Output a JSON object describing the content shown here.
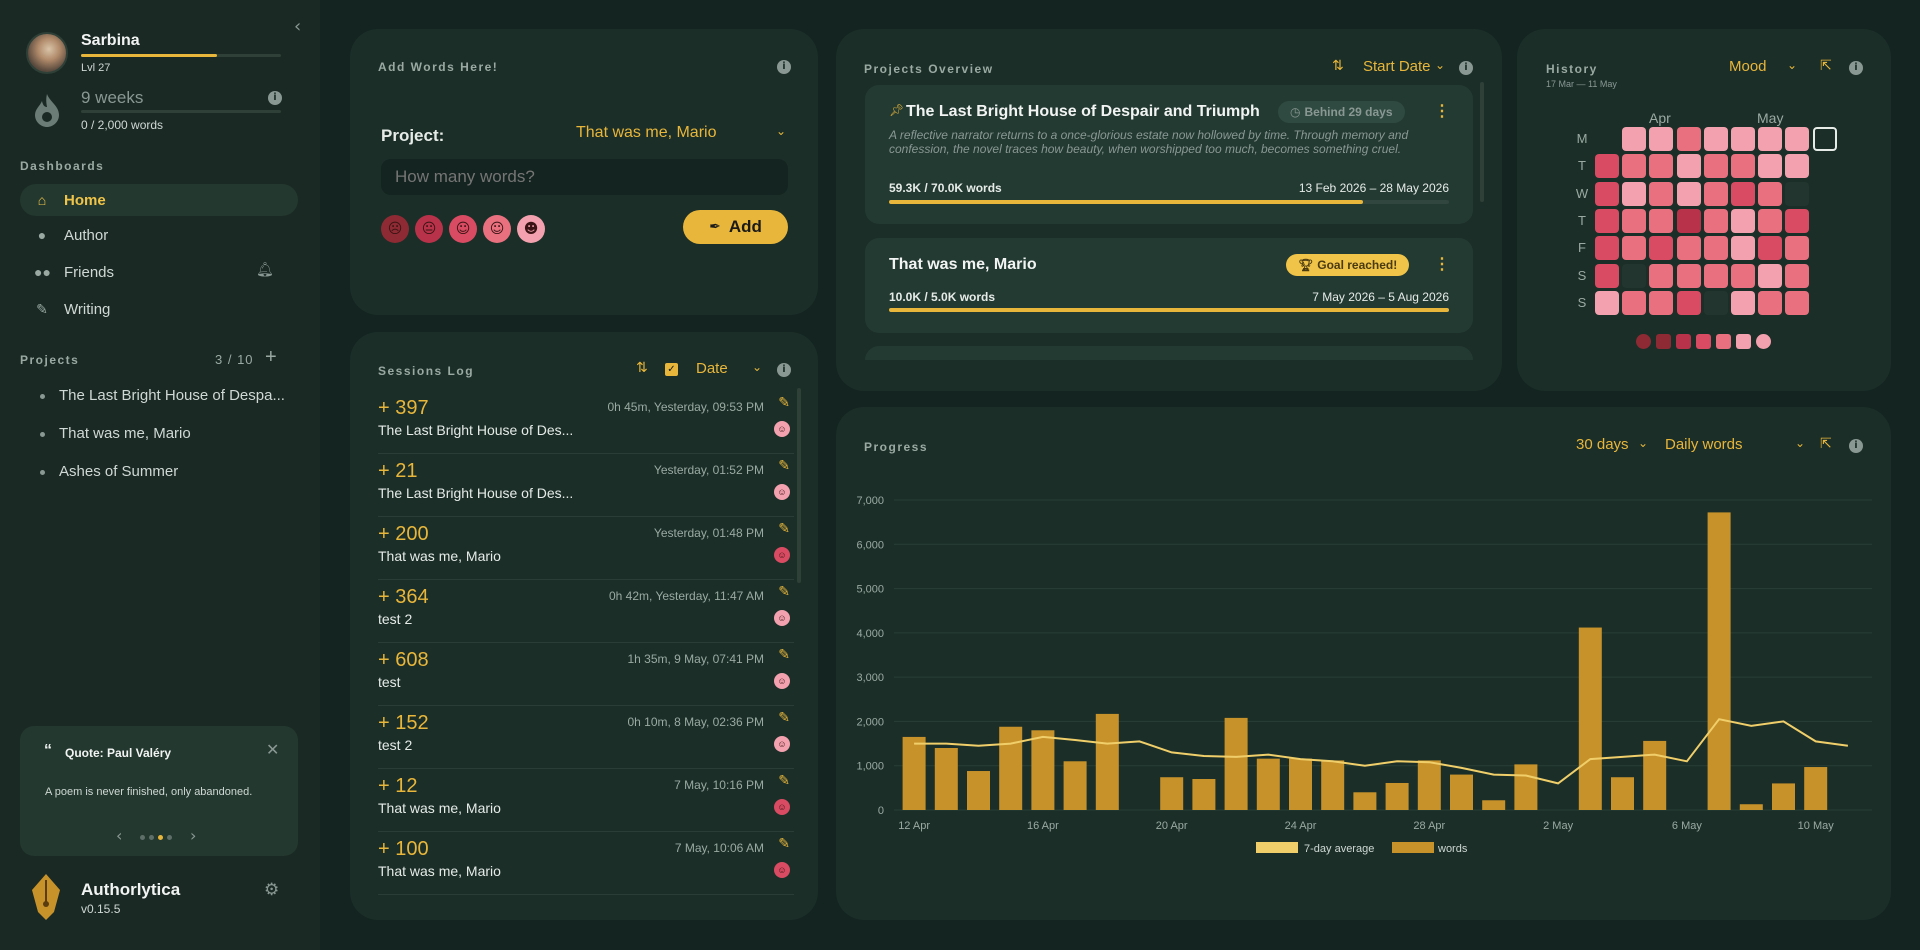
{
  "user": {
    "name": "Sarbina",
    "level": "Lvl 27",
    "level_progress": 0.68
  },
  "streak": {
    "weeks": "9 weeks",
    "words": "0 / 2,000 words"
  },
  "sidebar": {
    "dashboards_title": "Dashboards",
    "nav": [
      {
        "label": "Home",
        "icon": "home-icon"
      },
      {
        "label": "Author",
        "icon": "person-icon"
      },
      {
        "label": "Friends",
        "icon": "friends-icon"
      },
      {
        "label": "Writing",
        "icon": "pen-icon"
      }
    ],
    "projects_title": "Projects",
    "projects_count": "3 / 10",
    "projects": [
      "The Last Bright House of Despa...",
      "That was me, Mario",
      "Ashes of Summer"
    ],
    "quote_title": "Quote: Paul Valéry",
    "quote_text": "A poem is never finished, only abandoned.",
    "app_name": "Authorlytica",
    "version": "v0.15.5"
  },
  "add_words": {
    "title": "Add Words Here!",
    "project_label": "Project:",
    "project_value": "That was me, Mario",
    "placeholder": "How many words?",
    "add_label": "Add",
    "mood_colors": [
      "#8e2a33",
      "#b8324a",
      "#d84b62",
      "#e8707f",
      "#f3a1ae"
    ]
  },
  "sessions": {
    "title": "Sessions Log",
    "sort_label": "Date",
    "items": [
      {
        "amount": "+ 397",
        "project": "The Last Bright House of Des...",
        "meta": "0h 45m, Yesterday, 09:53 PM",
        "mood": "#f3a1ae"
      },
      {
        "amount": "+ 21",
        "project": "The Last Bright House of Des...",
        "meta": "Yesterday, 01:52 PM",
        "mood": "#f3a1ae"
      },
      {
        "amount": "+ 200",
        "project": "That was me, Mario",
        "meta": "Yesterday, 01:48 PM",
        "mood": "#d84b62"
      },
      {
        "amount": "+ 364",
        "project": "test 2",
        "meta": "0h 42m, Yesterday, 11:47 AM",
        "mood": "#f3a1ae"
      },
      {
        "amount": "+ 608",
        "project": "test",
        "meta": "1h 35m, 9 May, 07:41 PM",
        "mood": "#f3a1ae"
      },
      {
        "amount": "+ 152",
        "project": "test 2",
        "meta": "0h 10m, 8 May, 02:36 PM",
        "mood": "#f3a1ae"
      },
      {
        "amount": "+ 12",
        "project": "That was me, Mario",
        "meta": "7 May, 10:16 PM",
        "mood": "#d84b62"
      },
      {
        "amount": "+ 100",
        "project": "That was me, Mario",
        "meta": "7 May, 10:06 AM",
        "mood": "#d84b62"
      }
    ]
  },
  "projects_overview": {
    "title": "Projects Overview",
    "sort_label": "Start Date",
    "cards": [
      {
        "title": "The Last Bright House of Despair and Triumph",
        "badge": "Behind 29 days",
        "description": "A reflective narrator returns to a once-glorious estate now hollowed by time. Through memory and confession, the novel traces how beauty, when worshipped too much, becomes something cruel.",
        "words": "59.3K / 70.0K words",
        "dates": "13 Feb 2026 – 28 May 2026",
        "progress": 0.847
      },
      {
        "title": "That was me, Mario",
        "badge": "Goal reached!",
        "words": "10.0K / 5.0K words",
        "dates": "7 May 2026 – 5 Aug 2026",
        "progress": 1.0
      }
    ]
  },
  "history": {
    "title": "History",
    "range": "17 Mar — 11 May",
    "mode": "Mood",
    "months": [
      "Apr",
      "May"
    ],
    "days": [
      "M",
      "T",
      "W",
      "T",
      "F",
      "S",
      "S"
    ]
  },
  "progress": {
    "title": "Progress",
    "range_label": "30 days",
    "metric_label": "Daily words"
  },
  "chart_data": {
    "type": "bar",
    "title": "",
    "xlabel": "",
    "ylabel": "",
    "ylim": [
      0,
      7000
    ],
    "yticks": [
      "0",
      "1,000",
      "2,000",
      "3,000",
      "4,000",
      "5,000",
      "6,000",
      "7,000"
    ],
    "xtick_labels": [
      "12 Apr",
      "16 Apr",
      "20 Apr",
      "24 Apr",
      "28 Apr",
      "2 May",
      "6 May",
      "10 May"
    ],
    "x": [
      "12 Apr",
      "13 Apr",
      "14 Apr",
      "15 Apr",
      "16 Apr",
      "17 Apr",
      "18 Apr",
      "19 Apr",
      "20 Apr",
      "21 Apr",
      "22 Apr",
      "23 Apr",
      "24 Apr",
      "25 Apr",
      "26 Apr",
      "27 Apr",
      "28 Apr",
      "29 Apr",
      "30 Apr",
      "1 May",
      "2 May",
      "3 May",
      "4 May",
      "5 May",
      "6 May",
      "7 May",
      "8 May",
      "9 May",
      "10 May",
      "11 May"
    ],
    "series": [
      {
        "name": "7-day average",
        "type": "line",
        "color": "#f0cf6a",
        "values": [
          1500,
          1500,
          1450,
          1500,
          1650,
          1580,
          1500,
          1550,
          1300,
          1220,
          1200,
          1250,
          1150,
          1100,
          1000,
          1100,
          1080,
          950,
          800,
          780,
          600,
          1150,
          1200,
          1250,
          1100,
          2050,
          1900,
          2000,
          1550,
          1450
        ]
      },
      {
        "name": "words",
        "type": "bar",
        "color": "#c8922a",
        "values": [
          1650,
          1400,
          880,
          1880,
          1800,
          1100,
          2170,
          0,
          740,
          700,
          2080,
          1160,
          1160,
          1120,
          400,
          610,
          1120,
          800,
          220,
          1030,
          0,
          4120,
          740,
          1560,
          0,
          6720,
          130,
          600,
          970,
          0
        ]
      }
    ],
    "legend": "bottom"
  }
}
